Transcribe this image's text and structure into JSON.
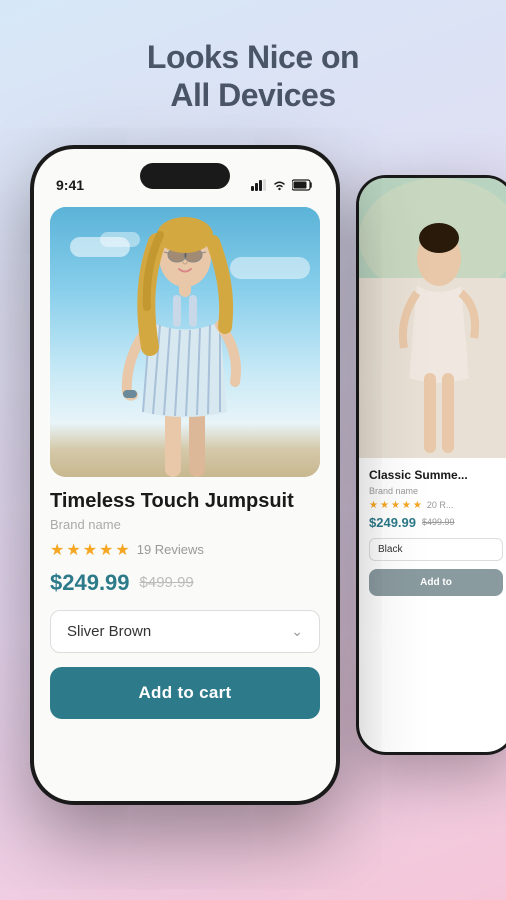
{
  "headline": {
    "line1": "Looks Nice on",
    "line2": "All Devices"
  },
  "main_phone": {
    "status": {
      "time": "9:41",
      "signal": "▲▲▲",
      "wifi": "wifi",
      "battery": "battery"
    },
    "product": {
      "title": "Timeless Touch Jumpsuit",
      "brand": "Brand name",
      "rating": 5,
      "reviews_count": "19 Reviews",
      "price_current": "$249.99",
      "price_original": "$499.99",
      "color_selected": "Sliver Brown",
      "add_to_cart_label": "Add to cart"
    }
  },
  "bg_phone": {
    "product": {
      "title": "Classic Summe...",
      "brand": "Brand name",
      "rating": 5,
      "reviews_count": "20 R...",
      "price_current": "$249.99",
      "price_original": "$499.99",
      "color_selected": "Black",
      "add_to_cart_label": "Add to"
    }
  },
  "stars": [
    "★",
    "★",
    "★",
    "★",
    "★"
  ],
  "colors": {
    "accent": "#2d7a8a",
    "star_color": "#f5a623",
    "bg_button": "#8a9ba0"
  }
}
